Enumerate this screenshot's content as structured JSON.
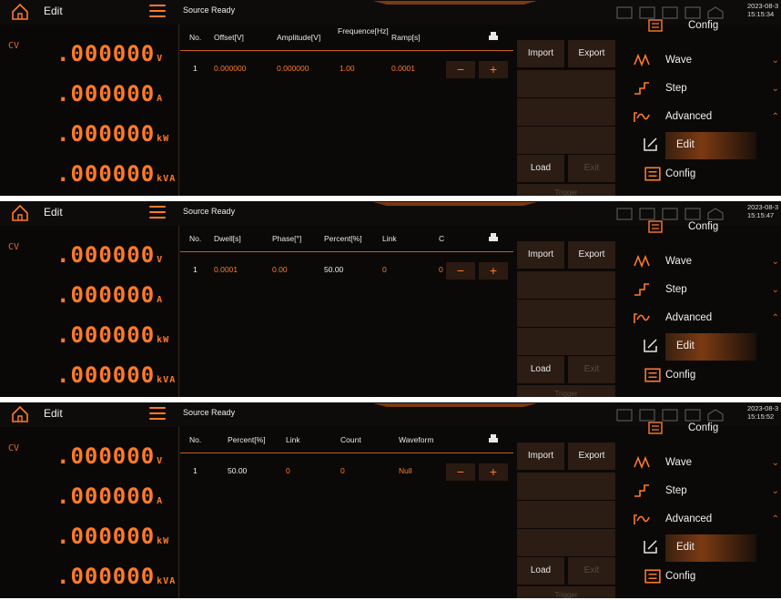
{
  "common": {
    "title": "Edit",
    "source": "Source",
    "status": "Ready",
    "mode": "CV",
    "readouts": [
      {
        "value": ".000000",
        "unit": "V"
      },
      {
        "value": ".000000",
        "unit": "A"
      },
      {
        "value": ".000000",
        "unit": "kW"
      },
      {
        "value": ".000000",
        "unit": "kVA"
      }
    ],
    "buttons": {
      "import": "Import",
      "export": "Export",
      "load": "Load",
      "exit": "Exit",
      "trigger": "Trigger"
    },
    "sidebar": {
      "config_top": "Config",
      "wave": "Wave",
      "step": "Step",
      "advanced": "Advanced",
      "edit": "Edit",
      "config": "Config"
    },
    "icons": [
      "home-icon",
      "menu-icon",
      "print-icon",
      "wave-icon",
      "step-icon",
      "advanced-icon",
      "edit-icon",
      "config-icon"
    ],
    "accent": "#ff7a2a"
  },
  "panels": [
    {
      "date": "2023-08-3",
      "time": "15:15:34",
      "headers": [
        "No.",
        "Offset[V]",
        "Amplitude[V]",
        "Frequence[Hz]",
        "Ramp[s]"
      ],
      "row": [
        "1",
        "0.000000",
        "0.000000",
        "1.00",
        "0.0001"
      ]
    },
    {
      "date": "2023-08-3",
      "time": "15:15:47",
      "headers": [
        "No.",
        "Dwell[s]",
        "Phase[°]",
        "Percent[%]",
        "Link",
        "C"
      ],
      "row": [
        "1",
        "0.0001",
        "0.00",
        "50.00",
        "0",
        "0"
      ]
    },
    {
      "date": "2023-08-3",
      "time": "15:15:52",
      "headers": [
        "No.",
        "Percent[%]",
        "Link",
        "Count",
        "Waveform"
      ],
      "row": [
        "1",
        "50.00",
        "0",
        "0",
        "Null"
      ]
    }
  ]
}
